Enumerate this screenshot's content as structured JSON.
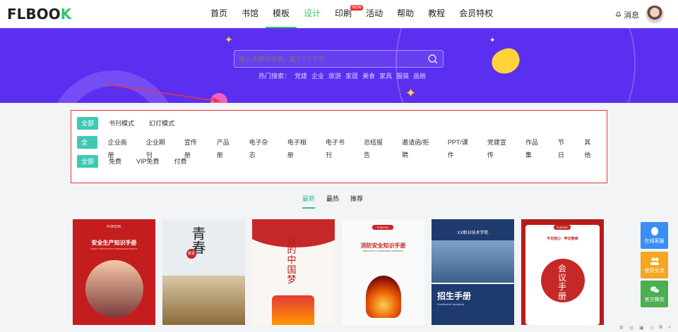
{
  "header": {
    "logo_text": "FLBOO",
    "logo_accent": "K",
    "nav": [
      {
        "label": "首页"
      },
      {
        "label": "书馆"
      },
      {
        "label": "模板"
      },
      {
        "label": "设计"
      },
      {
        "label": "印刷",
        "badge": "NEW"
      },
      {
        "label": "活动"
      },
      {
        "label": "帮助"
      },
      {
        "label": "教程"
      },
      {
        "label": "会员特权"
      }
    ],
    "messages_label": "消息"
  },
  "banner": {
    "search_placeholder": "输入关键词搜索，最少2个字符",
    "hot_label": "热门搜索：",
    "hot_words": [
      "党建",
      "企业",
      "旅游",
      "家居",
      "美食",
      "家具",
      "服装",
      "画册"
    ]
  },
  "filters": {
    "row1": [
      "全部",
      "书刊模式",
      "幻灯模式"
    ],
    "row2": [
      "全部",
      "企业画册",
      "企业期刊",
      "宣传册",
      "产品册",
      "电子杂志",
      "电子相册",
      "电子书刊",
      "总结报告",
      "邀请函/拒聘",
      "PPT/课件",
      "党建宣传",
      "作品集",
      "节日",
      "其他"
    ],
    "row3": [
      "全部",
      "免费",
      "VIP免费",
      "付费"
    ]
  },
  "sort_tabs": [
    "最新",
    "最热",
    "推荐"
  ],
  "cards": [
    {
      "title": "安全生产知识手册",
      "sub": "SAFETY PRODUCTION KNOWLEDGE MANUAL",
      "brand": "FLBOOK"
    },
    {
      "title": "青春",
      "sub": "致青春"
    },
    {
      "title": "我的中国梦"
    },
    {
      "title": "消防安全知识手册",
      "sub": "FIRE SAFETY KNOWLEDGE HANDBOOK",
      "brand": "FLBOOK"
    },
    {
      "title": "招生手册",
      "sub": "Enrollment Handbook",
      "school": "XX职业技术学院"
    },
    {
      "title": "会议手册",
      "sub": "不忘初心 · 牢记使命",
      "brand": "FLBOOK"
    }
  ],
  "side_tools": [
    {
      "label": "在线客服",
      "color": "#3a8ef6"
    },
    {
      "label": "使用交流",
      "color": "#f5a623"
    },
    {
      "label": "官方微信",
      "color": "#4caf50"
    }
  ],
  "colors": {
    "accent": "#2dc86b",
    "banner": "#5b2ff0",
    "chip": "#3cc9b5",
    "highlight_border": "#e53935"
  }
}
